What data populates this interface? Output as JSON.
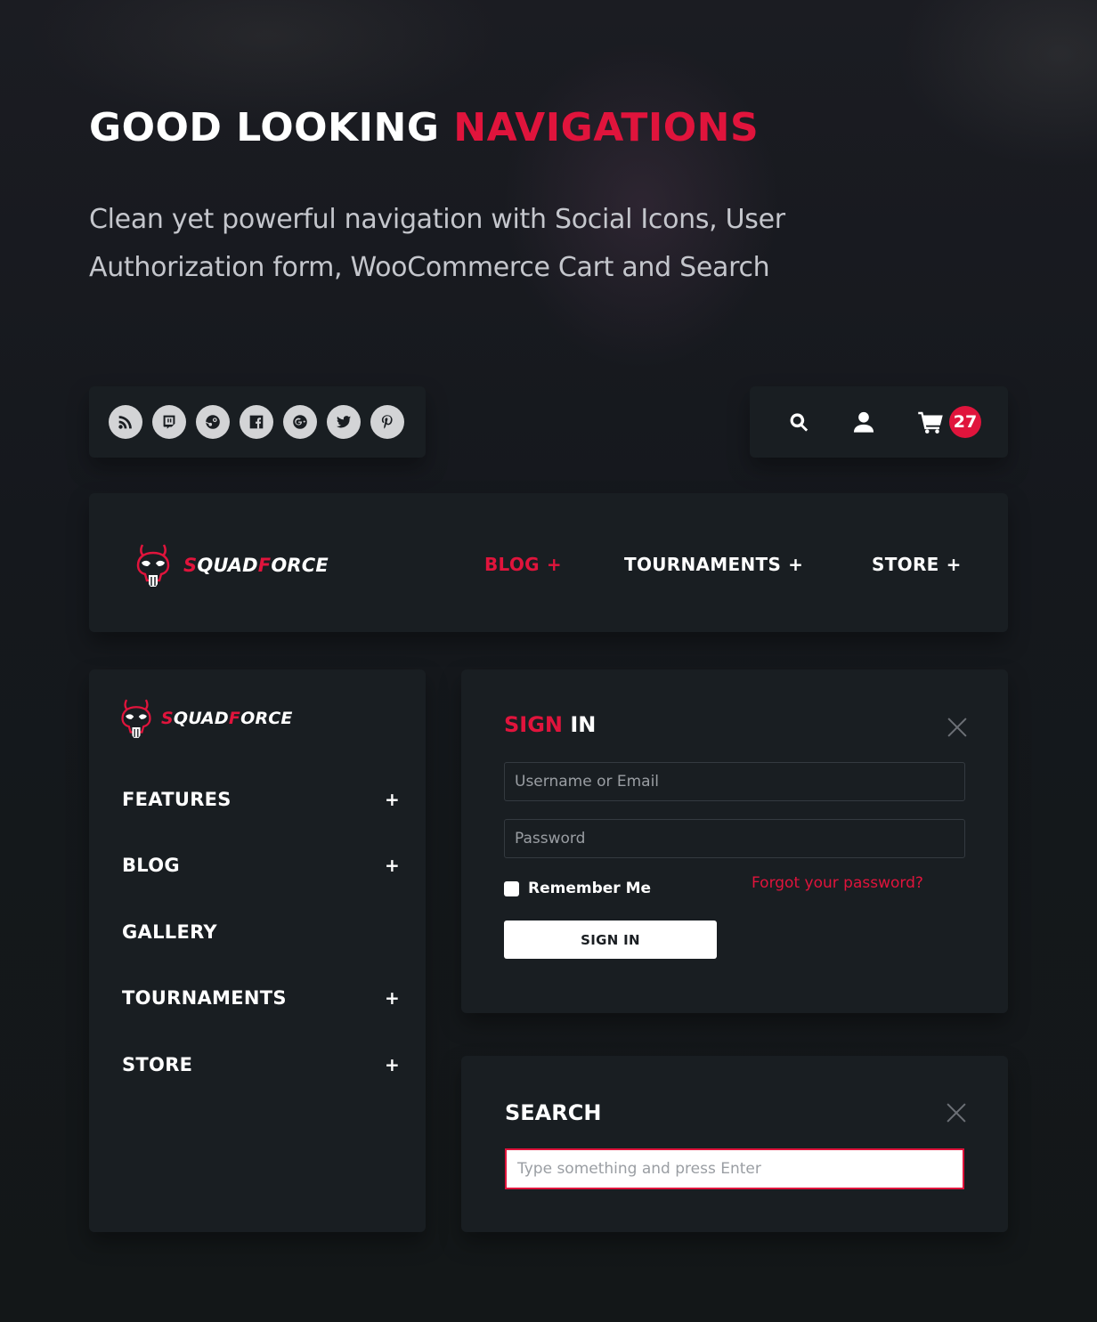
{
  "hero": {
    "title_main": "GOOD LOOKING ",
    "title_accent": "NAVIGATIONS",
    "subtitle": "Clean yet powerful navigation with Social Icons, User Authorization form, WooCommerce Cart and Search"
  },
  "social_bar": {
    "icons": [
      "rss-icon",
      "twitch-icon",
      "steam-icon",
      "facebook-icon",
      "google-plus-icon",
      "twitter-icon",
      "pinterest-icon"
    ]
  },
  "tools_bar": {
    "icons": [
      "search-icon",
      "user-icon",
      "cart-icon"
    ],
    "cart_count": "27"
  },
  "brand": {
    "logo_first_letter": "S",
    "logo_mid": "QUAD",
    "logo_second_letter": "F",
    "logo_end": "ORCE"
  },
  "header_nav": {
    "items": [
      {
        "label": "BLOG",
        "suffix": "+",
        "active": true
      },
      {
        "label": "TOURNAMENTS",
        "suffix": "+",
        "active": false
      },
      {
        "label": "STORE",
        "suffix": "+",
        "active": false
      }
    ]
  },
  "side_menu": {
    "items": [
      {
        "label": "FEATURES",
        "suffix": "+"
      },
      {
        "label": "BLOG",
        "suffix": "+"
      },
      {
        "label": "GALLERY",
        "suffix": ""
      },
      {
        "label": "TOURNAMENTS",
        "suffix": "+"
      },
      {
        "label": "STORE",
        "suffix": "+"
      }
    ]
  },
  "signin": {
    "title_accent": "SIGN",
    "title_rest": " IN",
    "username_placeholder": "Username or Email",
    "password_placeholder": "Password",
    "remember_label": "Remember Me",
    "forgot_link": "Forgot your password?",
    "submit_label": "SIGN IN"
  },
  "search": {
    "title": "SEARCH",
    "placeholder": "Type something and press Enter"
  },
  "colors": {
    "accent": "#e0143c",
    "panel": "#191e22",
    "background": "#15181d"
  }
}
